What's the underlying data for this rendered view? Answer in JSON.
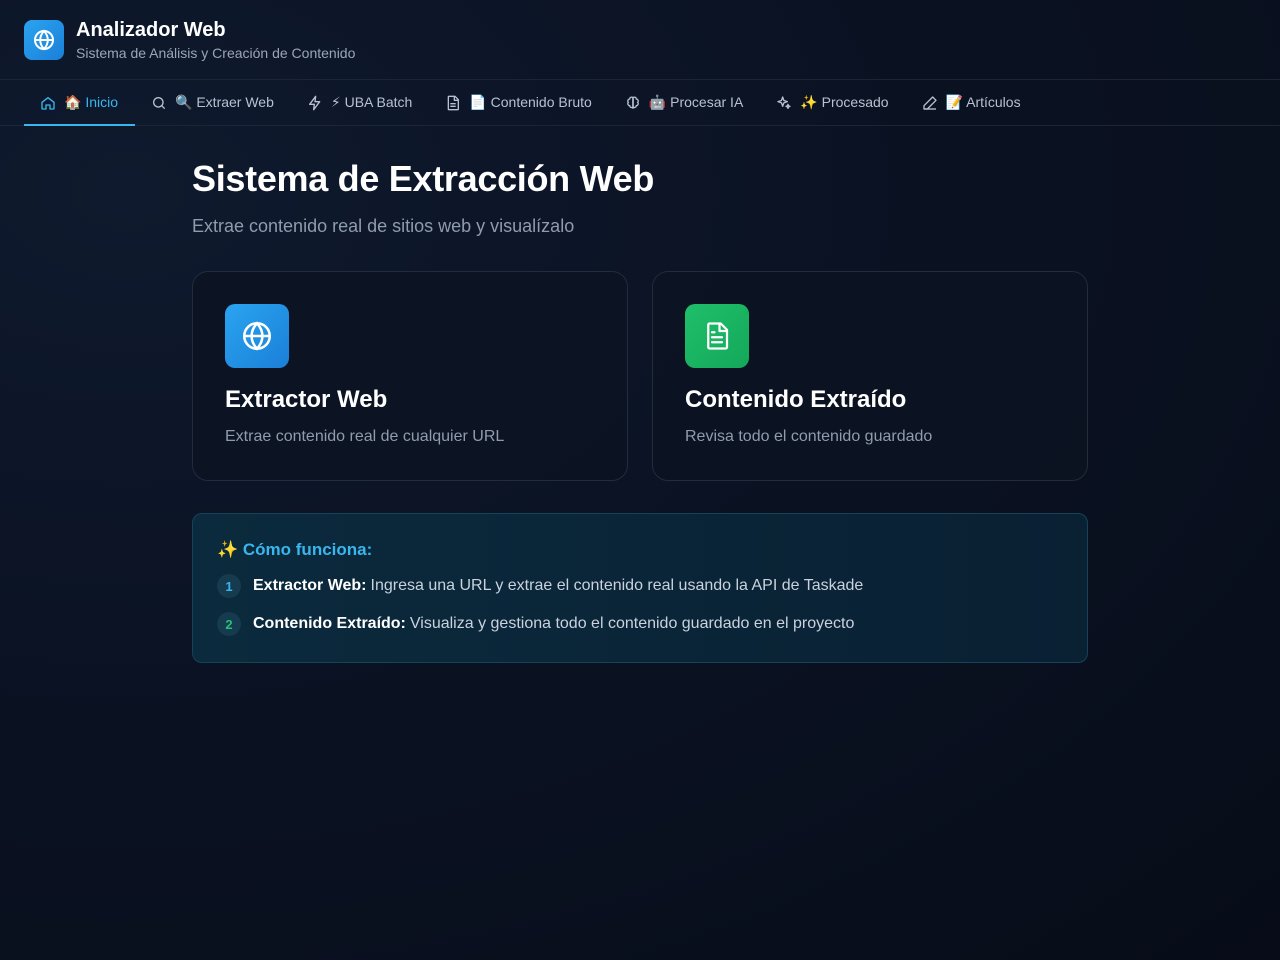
{
  "app": {
    "title": "Analizador Web",
    "subtitle": "Sistema de Análisis y Creación de Contenido",
    "logo_icon": "globe-icon"
  },
  "nav": {
    "items": [
      {
        "label": "🏠 Inicio",
        "icon": "home-icon",
        "active": true
      },
      {
        "label": "🔍 Extraer Web",
        "icon": "search-icon",
        "active": false
      },
      {
        "label": "⚡ UBA Batch",
        "icon": "bolt-icon",
        "active": false
      },
      {
        "label": "📄 Contenido Bruto",
        "icon": "document-icon",
        "active": false
      },
      {
        "label": "🤖 Procesar IA",
        "icon": "brain-icon",
        "active": false
      },
      {
        "label": "✨ Procesado",
        "icon": "sparkles-icon",
        "active": false
      },
      {
        "label": "📝 Artículos",
        "icon": "pencil-icon",
        "active": false
      }
    ]
  },
  "main": {
    "title": "Sistema de Extracción Web",
    "subtitle": "Extrae contenido real de sitios web y visualízalo",
    "cards": [
      {
        "title": "Extractor Web",
        "description": "Extrae contenido real de cualquier URL",
        "icon": "globe-icon",
        "color": "#1b8fe0"
      },
      {
        "title": "Contenido Extraído",
        "description": "Revisa todo el contenido guardado",
        "icon": "document-icon",
        "color": "#19b463"
      }
    ],
    "info": {
      "title": "✨ Cómo funciona:",
      "steps": [
        {
          "number": "1",
          "label": "Extractor Web:",
          "text": "Ingresa una URL y extrae el contenido real usando la API de Taskade"
        },
        {
          "number": "2",
          "label": "Contenido Extraído:",
          "text": "Visualiza y gestiona todo el contenido guardado en el proyecto"
        }
      ]
    }
  },
  "colors": {
    "accent": "#3ab6ee",
    "background": "#0b1324",
    "success": "#22c17a"
  }
}
